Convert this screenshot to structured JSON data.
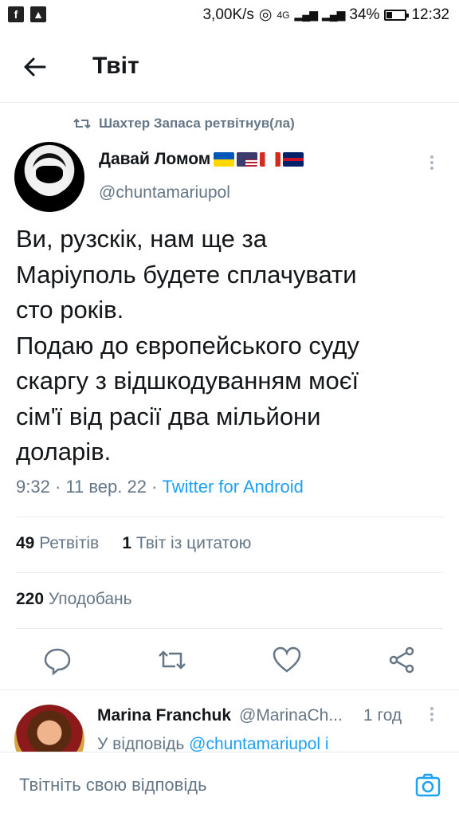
{
  "status_bar": {
    "net_speed": "3,00K/s",
    "network": "4G",
    "battery": "34%",
    "battery_level": 0.34,
    "time": "12:32"
  },
  "header": {
    "title": "Твіт"
  },
  "retweet_info": "Шахтер Запаса ретвітнув(ла)",
  "tweet": {
    "author_name": "Давай Ломом",
    "author_flags": [
      "ukraine-flag",
      "usa-flag",
      "canada-flag",
      "uk-flag"
    ],
    "handle": "@chuntamariupol",
    "text": "Ви, рузскік, нам ще за\nМаріуполь будете сплачувати\nсто років.\nПодаю до європейського суду\nскаргу з відшкодуванням моєї\nсім'ї від расії два мільйони\nдоларів.",
    "time": "9:32",
    "date": "11 вер. 22",
    "source": "Twitter for Android"
  },
  "stats": {
    "retweets_count": "49",
    "retweets_label": "Ретвітів",
    "quotes_count": "1",
    "quotes_label": "Твіт із цитатою",
    "likes_count": "220",
    "likes_label": "Уподобань"
  },
  "actions": [
    "reply-icon",
    "retweet-icon",
    "like-icon",
    "share-icon"
  ],
  "reply": {
    "author_name": "Marina Franchuk",
    "handle": "@MarinaCh...",
    "time": "1 год",
    "reply_prefix": "У відповідь",
    "reply_to": "@chuntamariupol і"
  },
  "composer": {
    "placeholder": "Твітніть свою відповідь"
  },
  "colors": {
    "accent": "#1da1f2",
    "muted": "#657786",
    "text": "#14171a"
  }
}
